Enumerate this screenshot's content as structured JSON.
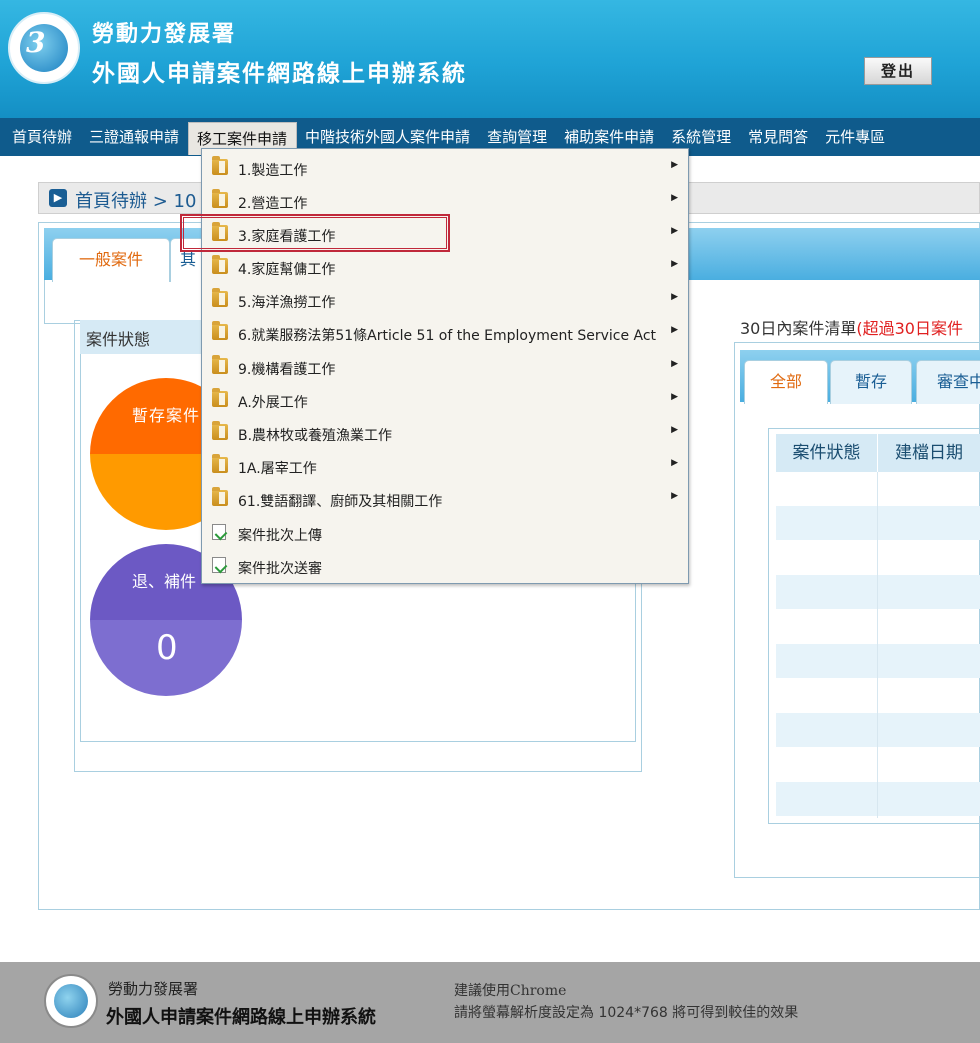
{
  "header": {
    "org_name": "勞動力發展署",
    "system_name": "外國人申請案件網路線上申辦系統",
    "logout_label": "登出"
  },
  "nav": {
    "items": [
      "首頁待辦",
      "三證通報申請",
      "移工案件申請",
      "中階技術外國人案件申請",
      "查詢管理",
      "補助案件申請",
      "系統管理",
      "常見問答",
      "元件專區"
    ],
    "active_index": 2
  },
  "breadcrumb": {
    "text": "首頁待辦 > 10"
  },
  "main_tabs": {
    "general": "一般案件",
    "other": "其"
  },
  "status_panel": {
    "title": "案件狀態",
    "draft_label": "暫存案件",
    "return_label": "退、補件",
    "return_count": "0"
  },
  "list_panel": {
    "title": "30日內案件清單",
    "title_warning": "(超過30日案件",
    "tabs": [
      "全部",
      "暫存",
      "審查中"
    ],
    "columns": [
      "案件狀態",
      "建檔日期"
    ]
  },
  "dropdown": {
    "items": [
      {
        "label": "1.製造工作",
        "type": "folder",
        "has_sub": true
      },
      {
        "label": "2.營造工作",
        "type": "folder",
        "has_sub": true
      },
      {
        "label": "3.家庭看護工作",
        "type": "folder",
        "has_sub": true
      },
      {
        "label": "4.家庭幫傭工作",
        "type": "folder",
        "has_sub": true
      },
      {
        "label": "5.海洋漁撈工作",
        "type": "folder",
        "has_sub": true
      },
      {
        "label": "6.就業服務法第51條Article 51 of the Employment Service Act",
        "type": "folder",
        "has_sub": true
      },
      {
        "label": "9.機構看護工作",
        "type": "folder",
        "has_sub": true
      },
      {
        "label": "A.外展工作",
        "type": "folder",
        "has_sub": true
      },
      {
        "label": "B.農林牧或養殖漁業工作",
        "type": "folder",
        "has_sub": true
      },
      {
        "label": "1A.屠宰工作",
        "type": "folder",
        "has_sub": true
      },
      {
        "label": "61.雙語翻譯、廚師及其相關工作",
        "type": "folder",
        "has_sub": true
      },
      {
        "label": "案件批次上傳",
        "type": "doc",
        "has_sub": false
      },
      {
        "label": "案件批次送審",
        "type": "doc",
        "has_sub": false
      }
    ],
    "highlighted_index": 2
  },
  "footer": {
    "org_name": "勞動力發展署",
    "system_name": "外國人申請案件網路線上申辦系統",
    "browser_note": "建議使用Chrome",
    "resolution_note": "請將螢幕解析度設定為 1024*768 將可得到較佳的效果"
  }
}
